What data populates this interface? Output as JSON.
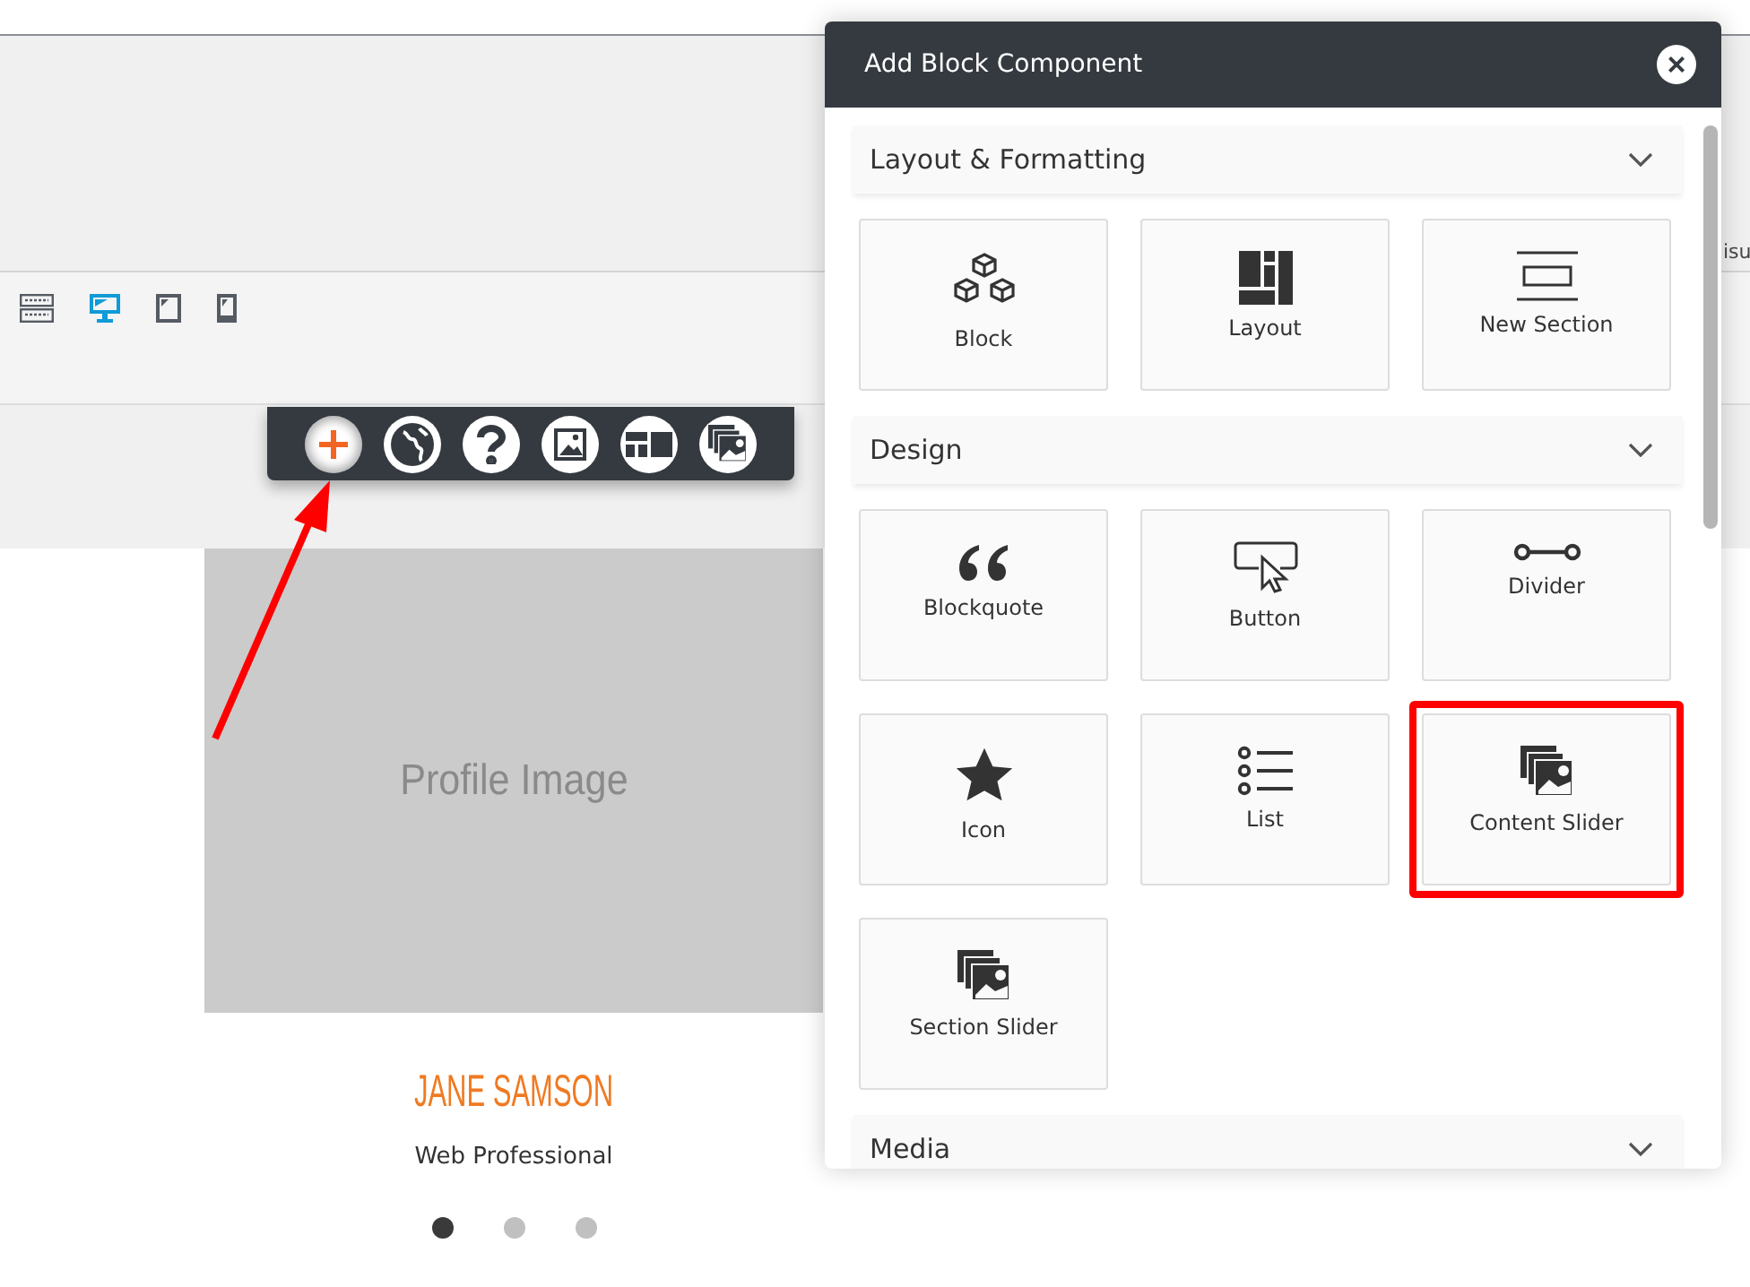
{
  "devices": [
    {
      "kind": "keyboard",
      "selected": false
    },
    {
      "kind": "desktop",
      "selected": true
    },
    {
      "kind": "tablet",
      "selected": false
    },
    {
      "kind": "phone",
      "selected": false
    }
  ],
  "toolbar": [
    {
      "kind": "plus",
      "selected": true
    },
    {
      "kind": "globe",
      "selected": false
    },
    {
      "kind": "help",
      "selected": false
    },
    {
      "kind": "image",
      "selected": false
    },
    {
      "kind": "layout",
      "selected": false
    },
    {
      "kind": "slider",
      "selected": false
    }
  ],
  "side_text": "isu",
  "profile": {
    "image_label": "Profile Image",
    "name": "JANE SAMSON",
    "title": "Web Professional",
    "dots": [
      {
        "selected": true
      },
      {
        "selected": false
      },
      {
        "selected": false
      }
    ]
  },
  "dialog": {
    "title": "Add Block Component",
    "close": "×",
    "sections": [
      {
        "title": "Layout & Formatting",
        "items": [
          {
            "label": "Block",
            "kind": "cubes",
            "highlighted": false
          },
          {
            "label": "Layout",
            "kind": "layout",
            "highlighted": false
          },
          {
            "label": "New Section",
            "kind": "section",
            "highlighted": false
          }
        ]
      },
      {
        "title": "Design",
        "items": [
          {
            "label": "Blockquote",
            "kind": "quote",
            "highlighted": false
          },
          {
            "label": "Button",
            "kind": "button",
            "highlighted": false
          },
          {
            "label": "Divider",
            "kind": "divider",
            "highlighted": false
          },
          {
            "label": "Icon",
            "kind": "star",
            "highlighted": false
          },
          {
            "label": "List",
            "kind": "list",
            "highlighted": false
          },
          {
            "label": "Content Slider",
            "kind": "slider",
            "highlighted": true
          },
          {
            "label": "Section Slider",
            "kind": "slider",
            "highlighted": false
          }
        ]
      },
      {
        "title": "Media"
      }
    ]
  }
}
